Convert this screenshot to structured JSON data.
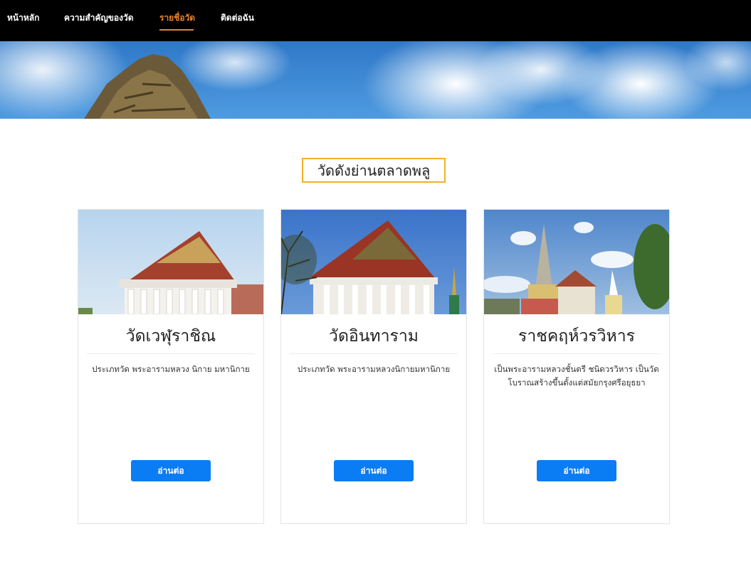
{
  "nav": {
    "items": [
      {
        "label": "หน้าหลัก"
      },
      {
        "label": "ความสำคัญของวัด"
      },
      {
        "label": "รายชื่อวัด"
      },
      {
        "label": "ติดต่อฉัน"
      }
    ],
    "active_index": 2,
    "active_color": "#e8832a"
  },
  "section": {
    "title": "วัดดังย่านตลาดพลู",
    "border_color": "#f2b12a"
  },
  "cards": [
    {
      "title": "วัดเวฬุราชิณ",
      "description": "ประเภทวัด พระอารามหลวง นิกาย มหานิกาย",
      "button_label": "อ่านต่อ"
    },
    {
      "title": "วัดอินทาราม",
      "description": "ประเภทวัด พระอารามหลวงนิกายมหานิกาย",
      "button_label": "อ่านต่อ"
    },
    {
      "title": "ราชคฤห์วรวิหาร",
      "description": "เป็นพระอารามหลวงชั้นตรี ชนิดวรวิหาร เป็นวัดโบราณสร้างขึ้นตั้งแต่สมัยกรุงศรีอยุธยา",
      "button_label": "อ่านต่อ"
    }
  ],
  "colors": {
    "nav_background": "#000000",
    "button": "#0a7cf4"
  }
}
